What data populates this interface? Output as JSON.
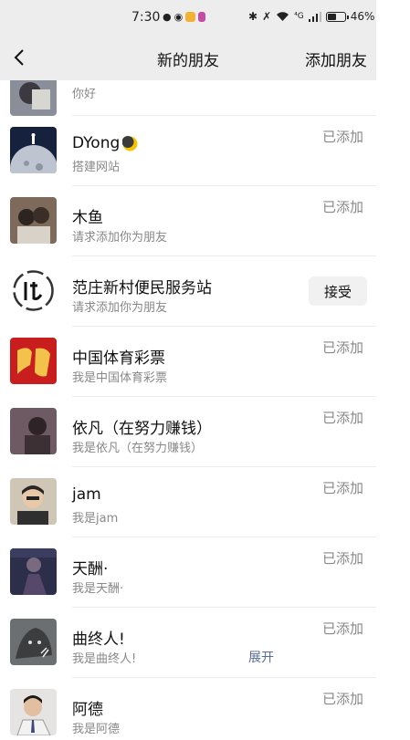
{
  "status_bar": {
    "time": "7:30",
    "network": "⁴G",
    "battery": "46%",
    "notification_colors": [
      "#555555",
      "#444444",
      "#f2b233",
      "#c64aa4"
    ]
  },
  "nav": {
    "title": "新的朋友",
    "action": "添加朋友"
  },
  "requests": [
    {
      "name": "",
      "message": "你好",
      "status": ""
    },
    {
      "name": "DYong",
      "message": "搭建网站",
      "status": "已添加"
    },
    {
      "name": "木鱼",
      "message": "请求添加你为朋友",
      "status": "已添加"
    },
    {
      "name": "范庄新村便民服务站",
      "message": "请求添加你为朋友",
      "status": "",
      "accept_label": "接受"
    },
    {
      "name": "中国体育彩票",
      "message": "我是中国体育彩票",
      "status": "已添加"
    },
    {
      "name": "依凡（在努力赚钱）",
      "message": "我是依凡（在努力赚钱）",
      "status": "已添加"
    },
    {
      "name": "jam",
      "message": "我是jam",
      "status": "已添加"
    },
    {
      "name": "天酬·",
      "message": "我是天酬·",
      "status": "已添加"
    },
    {
      "name": "曲终人!",
      "message": "我是曲终人!",
      "status": "已添加",
      "expand_label": "展开"
    },
    {
      "name": "阿德",
      "message": "我是阿德",
      "status": "已添加"
    }
  ],
  "colors": {
    "nav_background": "#ededed",
    "link": "#576b95",
    "secondary_text": "#888888"
  }
}
